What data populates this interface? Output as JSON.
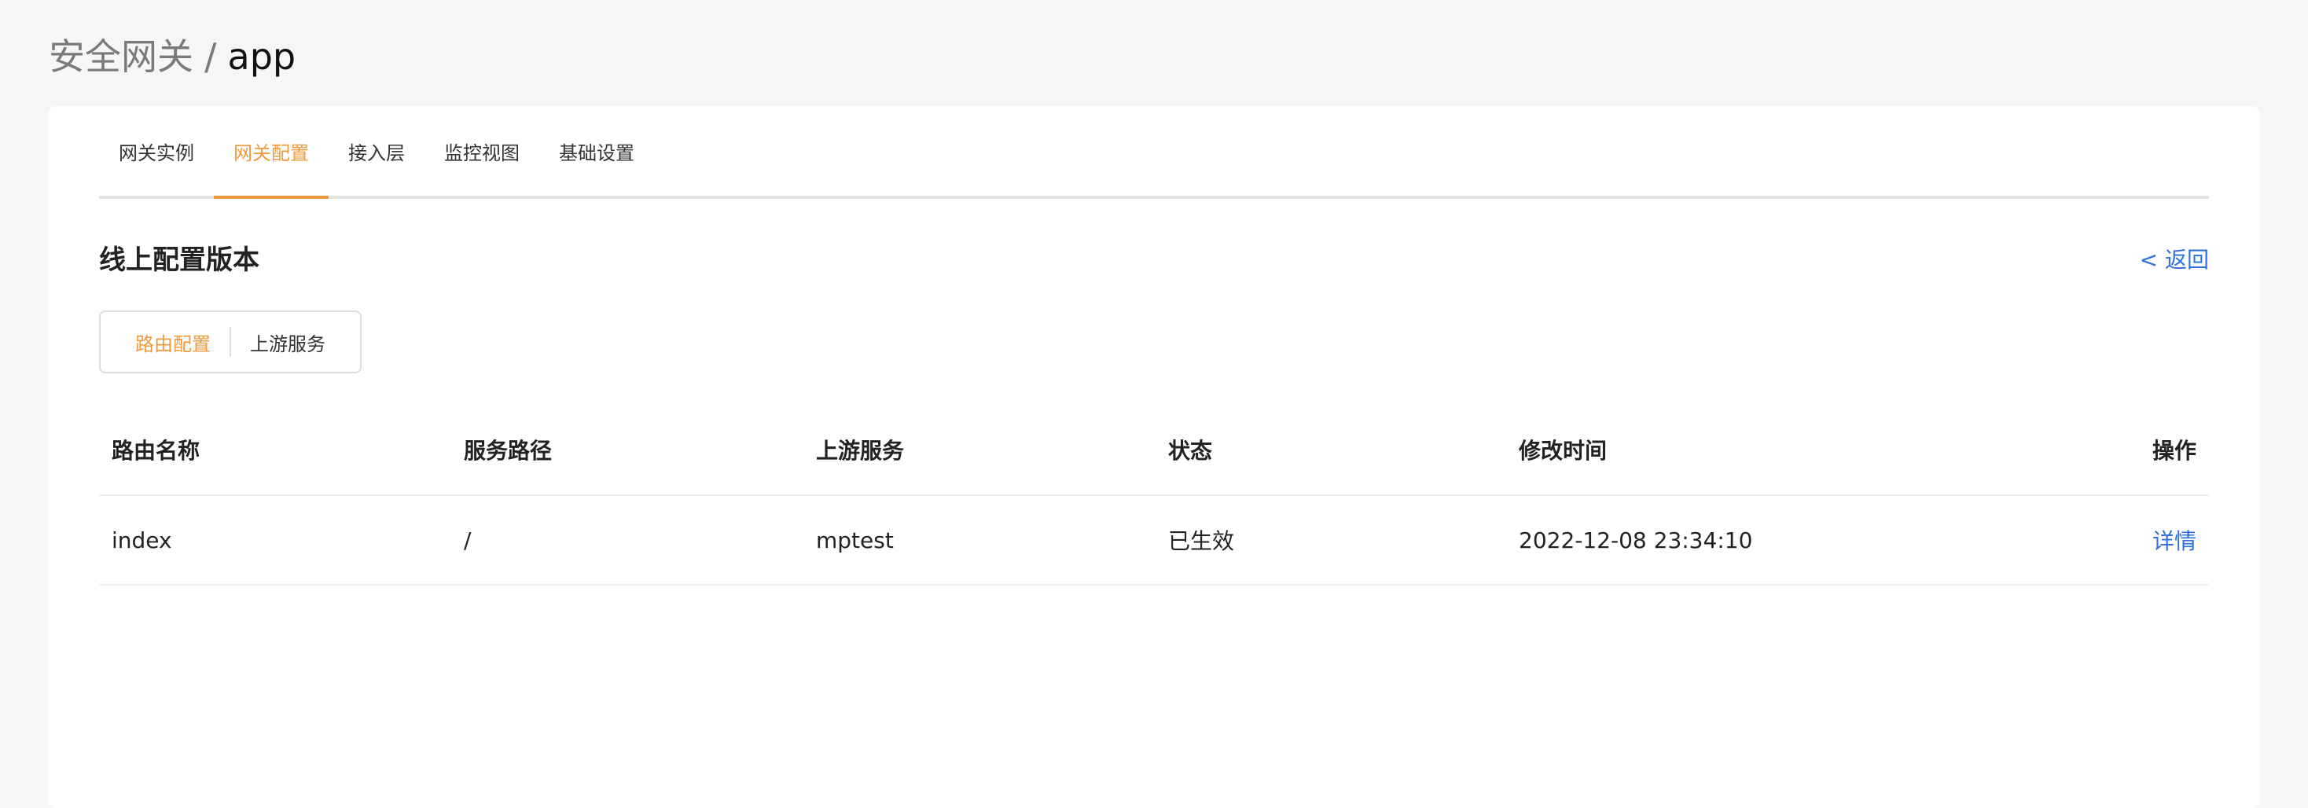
{
  "breadcrumb": {
    "parent": "安全网关",
    "separator": "/",
    "current": "app"
  },
  "tabs": [
    {
      "label": "网关实例",
      "active": false
    },
    {
      "label": "网关配置",
      "active": true
    },
    {
      "label": "接入层",
      "active": false
    },
    {
      "label": "监控视图",
      "active": false
    },
    {
      "label": "基础设置",
      "active": false
    }
  ],
  "section": {
    "title": "线上配置版本",
    "back_label": "< 返回"
  },
  "segment": {
    "options": [
      "路由配置",
      "上游服务"
    ],
    "selected": "路由配置"
  },
  "table": {
    "columns": [
      "路由名称",
      "服务路径",
      "上游服务",
      "状态",
      "修改时间",
      "操作"
    ],
    "rows": [
      {
        "name": "index",
        "path": "/",
        "upstream": "mptest",
        "status": "已生效",
        "modified": "2022-12-08 23:34:10",
        "action": "详情"
      }
    ]
  },
  "colors": {
    "accent": "#ef9a3c",
    "link": "#2f6fde",
    "background": "#f6f6f6"
  }
}
